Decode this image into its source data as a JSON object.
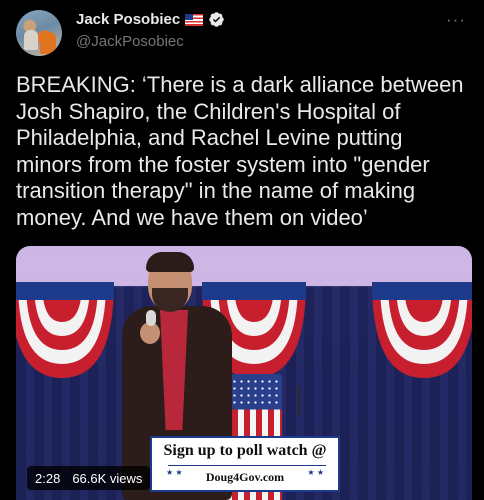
{
  "author": {
    "name": "Jack Posobiec",
    "handle": "@JackPosobiec",
    "flag_icon": "us-flag-emoji",
    "verified_icon": "verified-badge-icon",
    "verified_color": "#1d9bf0"
  },
  "more_icon": "more-options-icon",
  "tweet": {
    "text": "BREAKING: ‘There is a dark alliance between Josh Shapiro, the Children's Hospital of Philadelphia, and Rachel Levine putting minors from the foster system into \"gender transition therapy\" in the name of making money. And we have them on video’"
  },
  "media": {
    "overlay_line1": "Sign up to poll watch @",
    "overlay_line2": "Doug4Gov.com",
    "duration": "2:28",
    "views": "66.6K views"
  },
  "colors": {
    "background": "#000000",
    "text": "#e7e9ea",
    "secondary_text": "#71767b"
  }
}
